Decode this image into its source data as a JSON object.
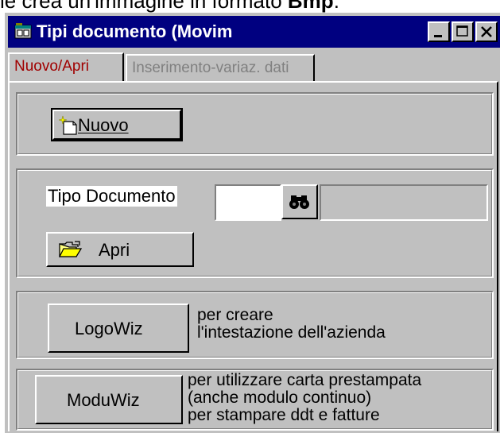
{
  "document_text": {
    "before": "le crea un'immagine in formato ",
    "bold": "Bmp",
    "after": "."
  },
  "window": {
    "title": "Tipi documento (Movim"
  },
  "tabs": [
    {
      "label": "Nuovo/Apri",
      "active": true
    },
    {
      "label": "Inserimento-variaz. dati",
      "active": false
    }
  ],
  "new_section": {
    "new_button": "Nuovo"
  },
  "open_section": {
    "doc_type_label": "Tipo Documento",
    "doc_type_value": "",
    "doc_type_description": "",
    "open_button": "Apri"
  },
  "logowiz_section": {
    "button": "LogoWiz",
    "description_lines": [
      "per creare",
      "l'intestazione dell'azienda"
    ]
  },
  "moduwiz_section": {
    "button": "ModuWiz",
    "description_lines": [
      "per utilizzare carta prestampata",
      "(anche modulo continuo)",
      "per stampare ddt e fatture"
    ]
  },
  "colors": {
    "titlebar": "#000080",
    "face": "#c0c0c0",
    "active_tab_text": "#a00000",
    "inactive_tab_text": "#808080"
  },
  "icons": {
    "window": "app-window-icon",
    "new": "new-document-icon",
    "search": "binoculars-icon",
    "open": "open-folder-icon"
  }
}
